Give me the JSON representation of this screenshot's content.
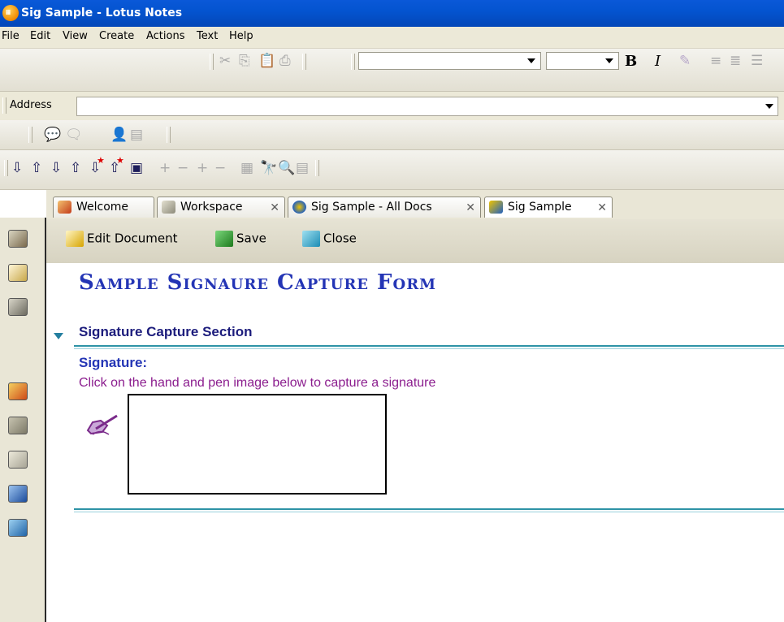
{
  "window": {
    "title": "Sig Sample - Lotus Notes"
  },
  "menu": [
    "File",
    "Edit",
    "View",
    "Create",
    "Actions",
    "Text",
    "Help"
  ],
  "format_toolbar": {
    "bold_label": "B",
    "italic_label": "I"
  },
  "address": {
    "label": "Address",
    "value": ""
  },
  "tabs": [
    {
      "label": "Welcome",
      "icon": "home-icon"
    },
    {
      "label": "Workspace",
      "icon": "workspace-icon"
    },
    {
      "label": "Sig Sample - All Docs",
      "icon": "database-icon"
    },
    {
      "label": "Sig Sample",
      "icon": "document-icon"
    }
  ],
  "actions": [
    {
      "label": "Edit Document",
      "icon": "edit-icon"
    },
    {
      "label": "Save",
      "icon": "save-icon"
    },
    {
      "label": "Close",
      "icon": "close-book-icon"
    }
  ],
  "form": {
    "title": "Sample Signaure Capture Form",
    "section_title": "Signature Capture Section",
    "signature_label": "Signature:",
    "signature_help": "Click on the hand and pen image below to capture a signature"
  },
  "colors": {
    "titlebar": "#0454d0",
    "form_title": "#2435b5",
    "section_rule": "#2e93a6",
    "help_text": "#8b1d8e"
  }
}
